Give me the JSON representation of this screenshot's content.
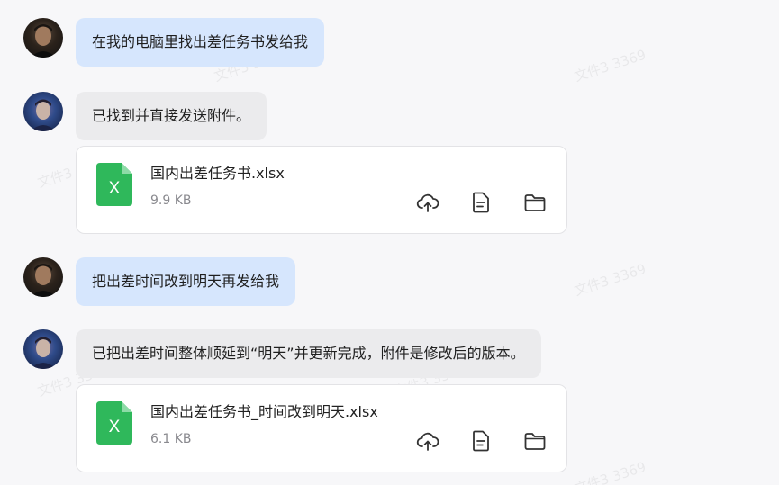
{
  "watermark_text": "文件3 3369",
  "messages": [
    {
      "role": "user",
      "text": "在我的电脑里找出差任务书发给我"
    },
    {
      "role": "assistant",
      "text": "已找到并直接发送附件。",
      "file": {
        "name": "国内出差任务书.xlsx",
        "size": "9.9 KB",
        "icon": "excel-file-icon",
        "icon_letter": "X"
      }
    },
    {
      "role": "user",
      "text": "把出差时间改到明天再发给我"
    },
    {
      "role": "assistant",
      "text": "已把出差时间整体顺延到“明天”并更新完成，附件是修改后的版本。",
      "file": {
        "name": "国内出差任务书_时间改到明天.xlsx",
        "size": "6.1 KB",
        "icon": "excel-file-icon",
        "icon_letter": "X"
      }
    }
  ],
  "file_actions": [
    "cloud-upload-icon",
    "document-icon",
    "folder-icon"
  ],
  "colors": {
    "user_bubble": "#d6e6fd",
    "assistant_bubble": "#ebebed",
    "excel_green": "#2fb85b",
    "background": "#f7f7f9"
  }
}
